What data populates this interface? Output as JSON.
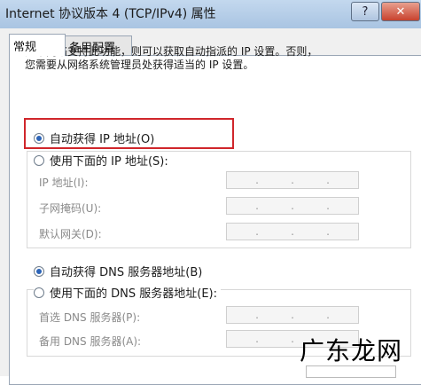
{
  "window": {
    "title": "Internet 协议版本 4 (TCP/IPv4) 属性",
    "help_label": "?",
    "close_label": "✕"
  },
  "tabs": [
    {
      "label": "常规"
    },
    {
      "label": "备用配置"
    }
  ],
  "description": [
    "如果网络支持此功能，则可以获取自动指派的 IP 设置。否则，",
    "您需要从网络系统管理员处获得适当的 IP 设置。"
  ],
  "ip_section": {
    "auto_label": "自动获得 IP 地址(O)",
    "manual_label": "使用下面的 IP 地址(S):",
    "selected": "auto",
    "fields": [
      {
        "label": "IP 地址(I):",
        "value": ". . ."
      },
      {
        "label": "子网掩码(U):",
        "value": ". . ."
      },
      {
        "label": "默认网关(D):",
        "value": ". . ."
      }
    ]
  },
  "dns_section": {
    "auto_label": "自动获得 DNS 服务器地址(B)",
    "manual_label": "使用下面的 DNS 服务器地址(E):",
    "selected": "auto",
    "fields": [
      {
        "label": "首选 DNS 服务器(P):",
        "value": ". . ."
      },
      {
        "label": "备用 DNS 服务器(A):",
        "value": ". . ."
      }
    ]
  },
  "watermark": "广东龙网",
  "colors": {
    "highlight": "#d0262b",
    "radio_selected": "#2c64b8"
  }
}
